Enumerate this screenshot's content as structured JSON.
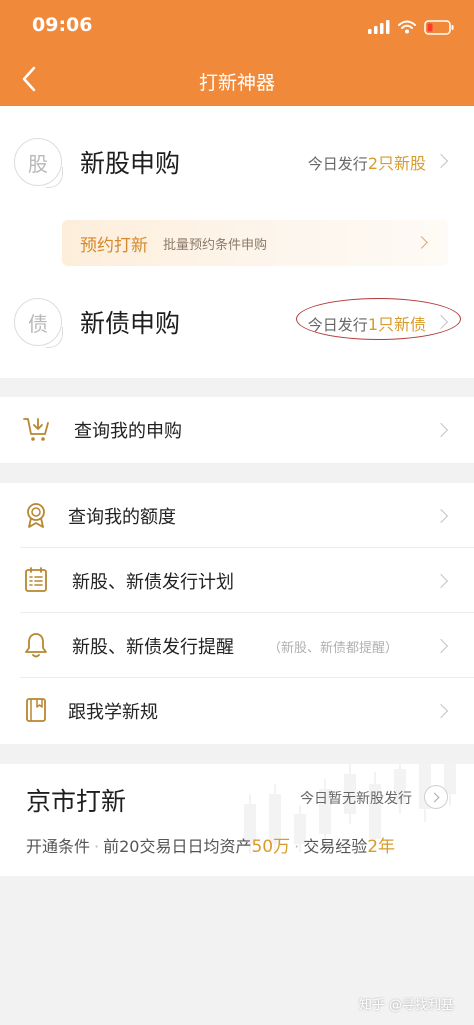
{
  "status_bar": {
    "time": "09:06"
  },
  "nav": {
    "title": "打新神器"
  },
  "new_stock": {
    "badge": "股",
    "title": "新股申购",
    "today_prefix": "今日发行",
    "today_count": "2只新股"
  },
  "promo": {
    "title": "预约打新",
    "subtitle": "批量预约条件申购"
  },
  "new_bond": {
    "badge": "债",
    "title": "新债申购",
    "today_prefix": "今日发行",
    "today_count": "1只新债"
  },
  "menu": {
    "query_subscription": "查询我的申购",
    "query_quota": "查询我的额度",
    "issue_plan": "新股、新债发行计划",
    "issue_reminder": "新股、新债发行提醒",
    "issue_reminder_hint": "（新股、新债都提醒）",
    "learn_rules": "跟我学新规"
  },
  "bjs": {
    "title": "京市打新",
    "today": "今日暂无新股发行",
    "cond_label": "开通条件",
    "cond1_prefix": "前20交易日日均资产",
    "cond1_value": "50万",
    "cond2_prefix": "交易经验",
    "cond2_value": "2年"
  },
  "watermark": "知乎 @寻找利基",
  "colors": {
    "header": "#f08a3a",
    "accent": "#d99b2b",
    "icon": "#b8862f",
    "annotation": "#b23b3b"
  }
}
